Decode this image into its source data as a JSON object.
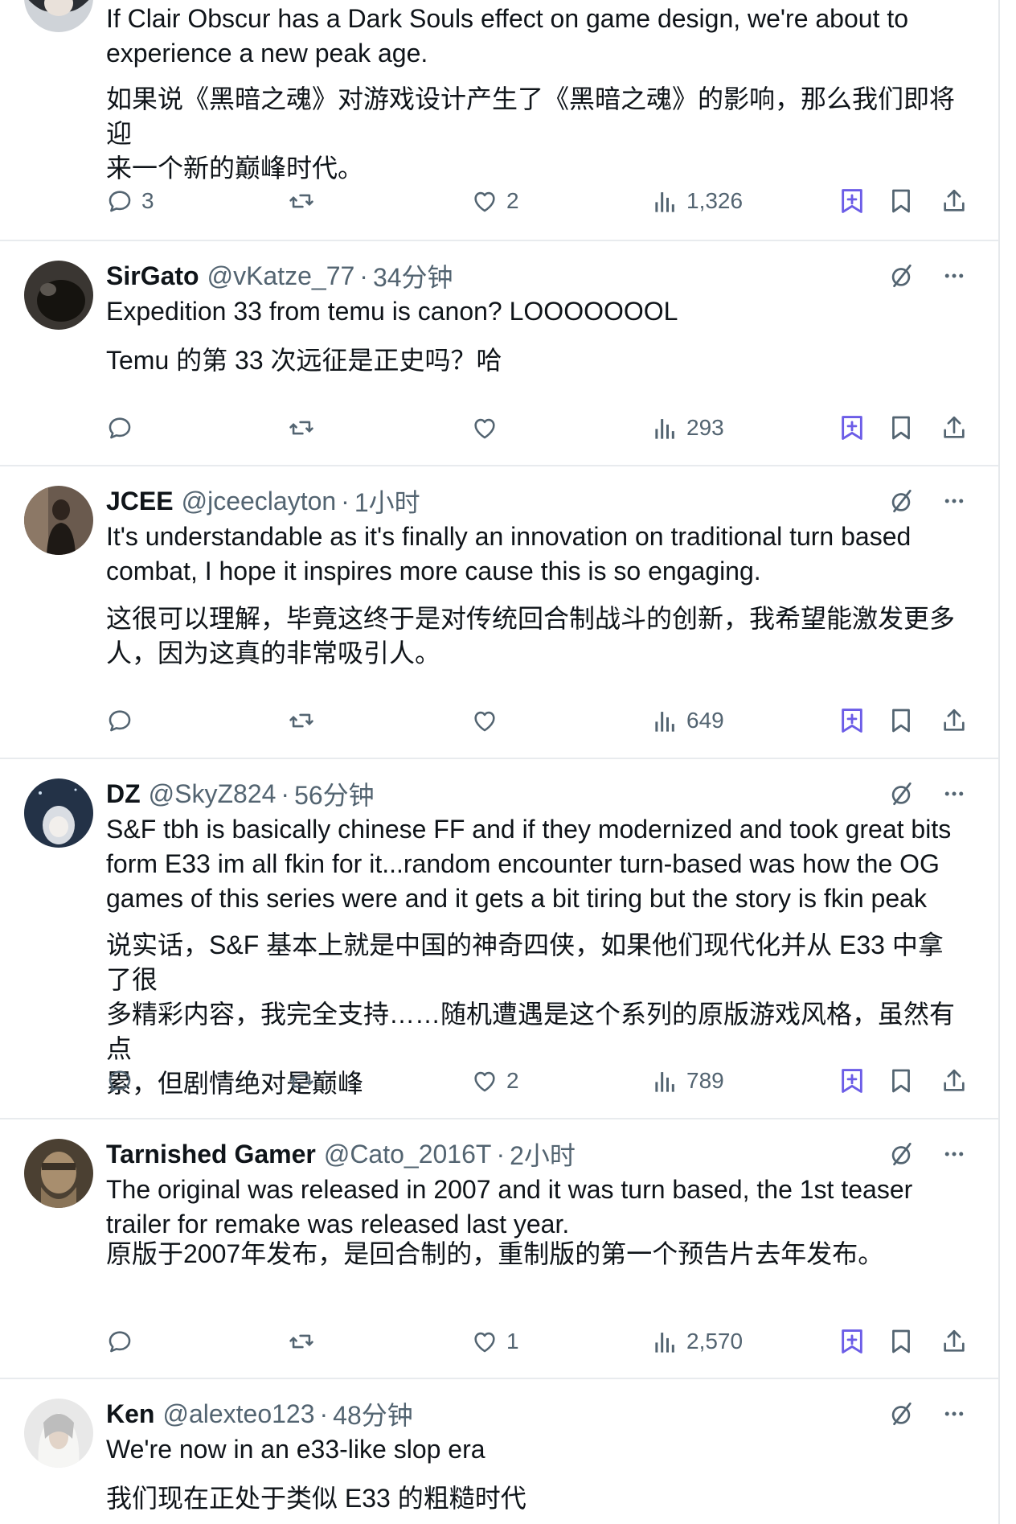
{
  "colors": {
    "text": "#0f1419",
    "muted": "#536471",
    "accent": "#6b5ce7",
    "divider": "#e8ebee"
  },
  "tweets": [
    {
      "name": "",
      "handle": "",
      "time": "",
      "text": "If Clair Obscur has a Dark Souls effect on game design, we're about to\nexperience a new peak age.",
      "translation": "如果说《黑暗之魂》对游戏设计产生了《黑暗之魂》的影响，那么我们即将迎\n来一个新的巅峰时代。",
      "replies": "3",
      "retweets": "",
      "likes": "2",
      "views": "1,326"
    },
    {
      "name": "SirGato",
      "handle": "@vKatze_77",
      "time": "34分钟",
      "text": "Expedition 33 from temu is canon? LOOOOOOOL",
      "translation": "Temu 的第 33 次远征是正史吗？哈",
      "replies": "",
      "retweets": "",
      "likes": "",
      "views": "293"
    },
    {
      "name": "JCEE",
      "handle": "@jceeclayton",
      "time": "1小时",
      "text": "It's understandable as it's finally an innovation on traditional turn based\ncombat, I hope it inspires more cause this is so engaging.",
      "translation": "这很可以理解，毕竟这终于是对传统回合制战斗的创新，我希望能激发更多\n人，因为这真的非常吸引人。",
      "replies": "",
      "retweets": "",
      "likes": "",
      "views": "649"
    },
    {
      "name": "DZ",
      "handle": "@SkyZ824",
      "time": "56分钟",
      "text": "S&F tbh is basically chinese FF and if they modernized and took great bits\nform E33 im all fkin for it...random encounter turn-based was how the OG\ngames of this series were and it gets a bit tiring but the story is fkin peak",
      "translation": "说实话，S&F 基本上就是中国的神奇四侠，如果他们现代化并从 E33 中拿了很\n多精彩内容，我完全支持……随机遭遇是这个系列的原版游戏风格，虽然有点\n累，但剧情绝对是巅峰",
      "replies": "",
      "retweets": "",
      "likes": "2",
      "views": "789"
    },
    {
      "name": "Tarnished Gamer",
      "handle": "@Cato_2016T",
      "time": "2小时",
      "text": "The original was released in 2007 and it was turn based, the 1st teaser\ntrailer for remake was released last year.",
      "translation": "原版于2007年发布，是回合制的，重制版的第一个预告片去年发布。",
      "replies": "",
      "retweets": "",
      "likes": "1",
      "views": "2,570"
    },
    {
      "name": "Ken",
      "handle": "@alexteo123",
      "time": "48分钟",
      "text": "We're now in an e33-like slop era",
      "translation": "我们现在正处于类似 E33 的粗糙时代",
      "replies": "",
      "retweets": "",
      "likes": "",
      "views": ""
    }
  ],
  "separator": "·",
  "icons": {
    "reply": "reply-icon",
    "retweet": "retweet-icon",
    "like": "heart-icon",
    "views": "views-icon",
    "grok": "grok-icon",
    "bookmark": "bookmark-icon",
    "share": "share-icon",
    "translate": "translate-icon",
    "more": "more-icon"
  }
}
